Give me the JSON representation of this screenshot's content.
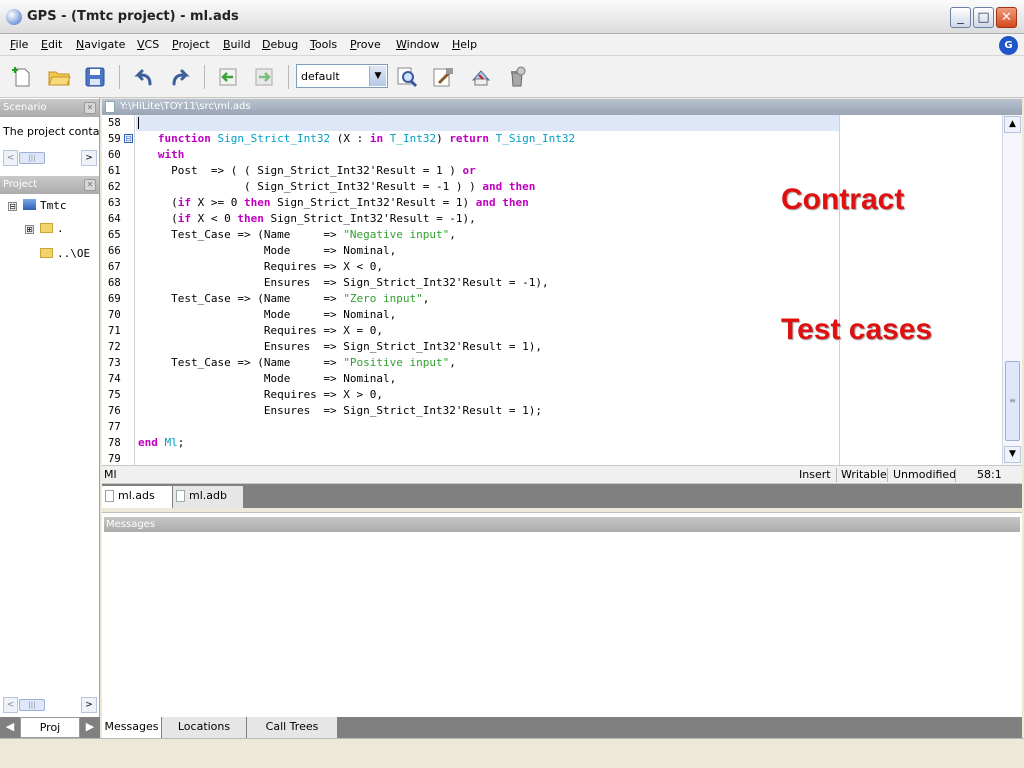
{
  "window": {
    "title": "GPS - (Tmtc project) - ml.ads",
    "minimize": "_",
    "maximize": "□",
    "close": "✕"
  },
  "menu": [
    "File",
    "Edit",
    "Navigate",
    "VCS",
    "Project",
    "Build",
    "Debug",
    "Tools",
    "Prove",
    "Window",
    "Help"
  ],
  "logo_letter": "G",
  "toolbar": {
    "scenario_combo": "default",
    "icons": [
      "new-file-icon",
      "open-folder-icon",
      "save-icon",
      "undo-icon",
      "redo-icon",
      "back-icon",
      "forward-icon",
      "search-icon",
      "build-icon",
      "compile-icon",
      "clean-icon"
    ]
  },
  "left": {
    "scenario_title": "Scenario",
    "scenario_text": "The project conta",
    "project_title": "Project",
    "tree": [
      {
        "label": "Tmtc",
        "expander": "⊟"
      },
      {
        "label": ".",
        "expander": "⊞"
      },
      {
        "label": "..\\OE"
      }
    ],
    "bottom_tab": "Proj"
  },
  "editor": {
    "path": "Y:\\HiLite\\TOY11\\src\\ml.ads",
    "fold_open": "⊟",
    "lines": [
      {
        "n": "58",
        "segs": []
      },
      {
        "n": "59",
        "fold": true,
        "segs": [
          {
            "t": "   function ",
            "c": "kw"
          },
          {
            "t": "Sign_Strict_Int32",
            "c": "ty"
          },
          {
            "t": " (X : "
          },
          {
            "t": "in ",
            "c": "kw"
          },
          {
            "t": "T_Int32",
            "c": "ty"
          },
          {
            "t": ") "
          },
          {
            "t": "return ",
            "c": "kw"
          },
          {
            "t": "T_Sign_Int32",
            "c": "ty"
          }
        ]
      },
      {
        "n": "60",
        "segs": [
          {
            "t": "   with",
            "c": "kw"
          }
        ]
      },
      {
        "n": "61",
        "segs": [
          {
            "t": "     Post  => ( ( Sign_Strict_Int32'Result = 1 ) "
          },
          {
            "t": "or",
            "c": "kw"
          }
        ]
      },
      {
        "n": "62",
        "segs": [
          {
            "t": "                ( Sign_Strict_Int32'Result = -1 ) ) "
          },
          {
            "t": "and then",
            "c": "kw"
          }
        ]
      },
      {
        "n": "63",
        "segs": [
          {
            "t": "     ("
          },
          {
            "t": "if ",
            "c": "kw"
          },
          {
            "t": "X >= 0 "
          },
          {
            "t": "then ",
            "c": "kw"
          },
          {
            "t": "Sign_Strict_Int32'Result = 1) "
          },
          {
            "t": "and then",
            "c": "kw"
          }
        ]
      },
      {
        "n": "64",
        "segs": [
          {
            "t": "     ("
          },
          {
            "t": "if ",
            "c": "kw"
          },
          {
            "t": "X < 0 "
          },
          {
            "t": "then ",
            "c": "kw"
          },
          {
            "t": "Sign_Strict_Int32'Result = -1),"
          }
        ]
      },
      {
        "n": "65",
        "segs": [
          {
            "t": "     Test_Case => (Name     => "
          },
          {
            "t": "\"Negative input\"",
            "c": "st"
          },
          {
            "t": ","
          }
        ]
      },
      {
        "n": "66",
        "segs": [
          {
            "t": "                   Mode     => Nominal,"
          }
        ]
      },
      {
        "n": "67",
        "segs": [
          {
            "t": "                   Requires => X < 0,"
          }
        ]
      },
      {
        "n": "68",
        "segs": [
          {
            "t": "                   Ensures  => Sign_Strict_Int32'Result = -1),"
          }
        ]
      },
      {
        "n": "69",
        "segs": [
          {
            "t": "     Test_Case => (Name     => "
          },
          {
            "t": "\"Zero input\"",
            "c": "st"
          },
          {
            "t": ","
          }
        ]
      },
      {
        "n": "70",
        "segs": [
          {
            "t": "                   Mode     => Nominal,"
          }
        ]
      },
      {
        "n": "71",
        "segs": [
          {
            "t": "                   Requires => X = 0,"
          }
        ]
      },
      {
        "n": "72",
        "segs": [
          {
            "t": "                   Ensures  => Sign_Strict_Int32'Result = 1),"
          }
        ]
      },
      {
        "n": "73",
        "segs": [
          {
            "t": "     Test_Case => (Name     => "
          },
          {
            "t": "\"Positive input\"",
            "c": "st"
          },
          {
            "t": ","
          }
        ]
      },
      {
        "n": "74",
        "segs": [
          {
            "t": "                   Mode     => Nominal,"
          }
        ]
      },
      {
        "n": "75",
        "segs": [
          {
            "t": "                   Requires => X > 0,"
          }
        ]
      },
      {
        "n": "76",
        "segs": [
          {
            "t": "                   Ensures  => Sign_Strict_Int32'Result = 1);"
          }
        ]
      },
      {
        "n": "77",
        "segs": []
      },
      {
        "n": "78",
        "segs": [
          {
            "t": "end ",
            "c": "kw"
          },
          {
            "t": "Ml",
            "c": "ty"
          },
          {
            "t": ";"
          }
        ]
      },
      {
        "n": "79",
        "segs": []
      }
    ],
    "annotations": [
      "Contract",
      "Test cases"
    ]
  },
  "status": {
    "left": "Ml",
    "insert": "Insert",
    "writable": "Writable",
    "modified": "Unmodified",
    "position": "58:1"
  },
  "file_tabs": [
    "ml.ads",
    "ml.adb"
  ],
  "messages": {
    "title": "Messages",
    "tabs": [
      "Messages",
      "Locations",
      "Call Trees"
    ]
  }
}
